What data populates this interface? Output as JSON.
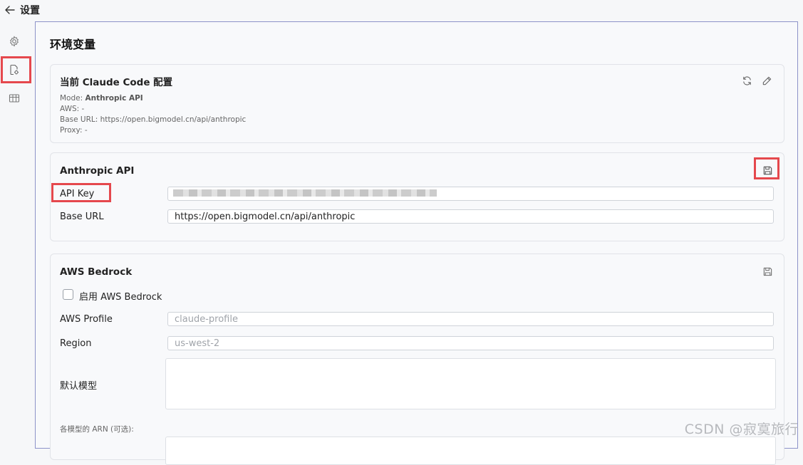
{
  "header": {
    "title": "设置"
  },
  "main": {
    "section_title": "环境变量",
    "current_config": {
      "title": "当前 Claude Code 配置",
      "mode_label": "Mode: ",
      "mode_value": "Anthropic API",
      "aws_line": "AWS: -",
      "base_url_line": "Base URL: https://open.bigmodel.cn/api/anthropic",
      "proxy_line": "Proxy: -"
    },
    "anthropic": {
      "title": "Anthropic API",
      "api_key_label": "API Key",
      "base_url_label": "Base URL",
      "base_url_value": "https://open.bigmodel.cn/api/anthropic"
    },
    "bedrock": {
      "title": "AWS Bedrock",
      "enable_label": "启用 AWS Bedrock",
      "profile_label": "AWS Profile",
      "profile_placeholder": "claude-profile",
      "region_label": "Region",
      "region_placeholder": "us-west-2",
      "default_model_label": "默认模型",
      "arn_label": "各模型的 ARN (可选):"
    }
  },
  "watermark": "CSDN @寂寞旅行",
  "colors": {
    "highlight": "#e5484d",
    "border": "#8d93c9"
  }
}
